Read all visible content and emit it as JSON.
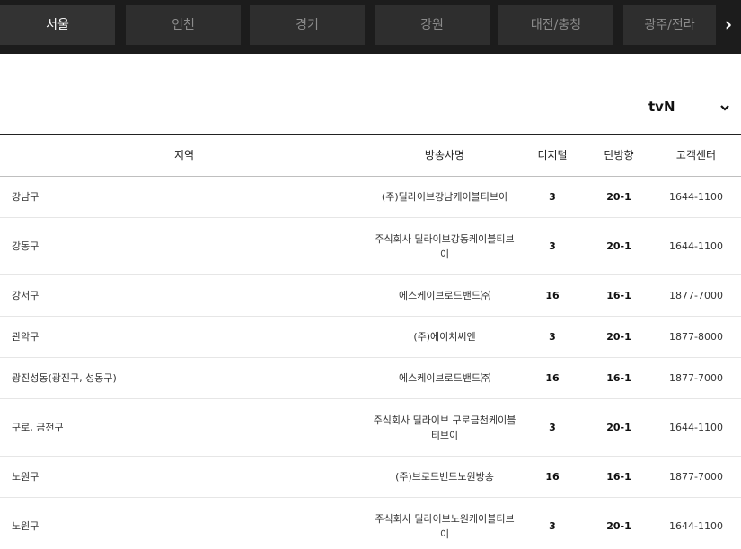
{
  "tabs": [
    {
      "label": "서울",
      "active": true
    },
    {
      "label": "인천",
      "active": false
    },
    {
      "label": "경기",
      "active": false
    },
    {
      "label": "강원",
      "active": false
    },
    {
      "label": "대전/충청",
      "active": false
    },
    {
      "label": "광주/전라",
      "active": false
    }
  ],
  "nav": {
    "next_icon": "chevron-right-icon"
  },
  "channel_select": {
    "value": "tvN",
    "icon": "chevron-down-icon"
  },
  "table": {
    "headers": {
      "region": "지역",
      "broadcaster": "방송사명",
      "digital": "디지털",
      "one_way": "단방향",
      "support": "고객센터"
    },
    "rows": [
      {
        "region": "강남구",
        "broadcaster": "(주)딜라이브강남케이블티브이",
        "digital": "3",
        "one_way": "20-1",
        "support": "1644-1100"
      },
      {
        "region": "강동구",
        "broadcaster": "주식회사 딜라이브강동케이블티브이",
        "digital": "3",
        "one_way": "20-1",
        "support": "1644-1100"
      },
      {
        "region": "강서구",
        "broadcaster": "에스케이브로드밴드㈜",
        "digital": "16",
        "one_way": "16-1",
        "support": "1877-7000"
      },
      {
        "region": "관악구",
        "broadcaster": "(주)에이치씨엔",
        "digital": "3",
        "one_way": "20-1",
        "support": "1877-8000"
      },
      {
        "region": "광진성동(광진구, 성동구)",
        "broadcaster": "에스케이브로드밴드㈜",
        "digital": "16",
        "one_way": "16-1",
        "support": "1877-7000"
      },
      {
        "region": "구로, 금천구",
        "broadcaster": "주식회사 딜라이브 구로금천케이블티브이",
        "digital": "3",
        "one_way": "20-1",
        "support": "1644-1100"
      },
      {
        "region": "노원구",
        "broadcaster": "(주)브로드밴드노원방송",
        "digital": "16",
        "one_way": "16-1",
        "support": "1877-7000"
      },
      {
        "region": "노원구",
        "broadcaster": "주식회사 딜라이브노원케이블티브이",
        "digital": "3",
        "one_way": "20-1",
        "support": "1644-1100"
      }
    ]
  }
}
